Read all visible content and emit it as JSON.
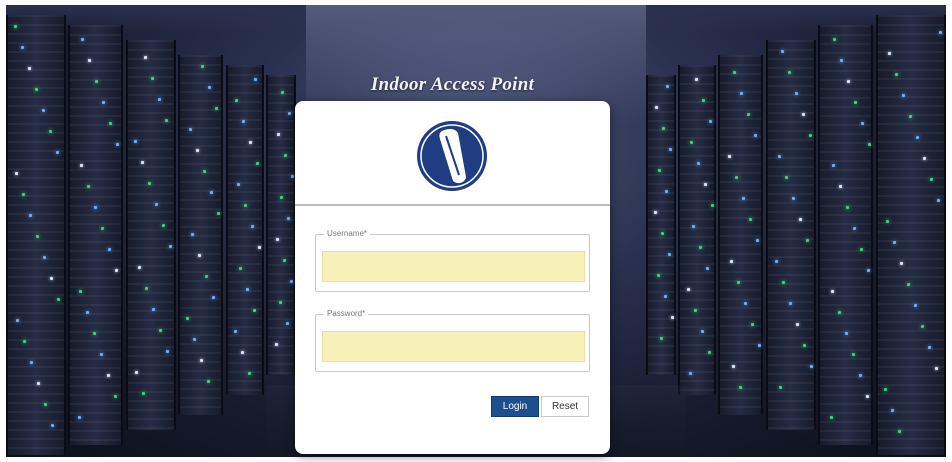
{
  "app": {
    "title": "Indoor Access Point"
  },
  "login": {
    "username_label": "Username*",
    "username_value": "",
    "password_label": "Password*",
    "password_value": "",
    "login_button": "Login",
    "reset_button": "Reset"
  },
  "colors": {
    "brand_blue": "#1d4f8e",
    "input_fill": "#f7f0b8"
  },
  "icons": {
    "logo": "brand-logo-icon"
  }
}
